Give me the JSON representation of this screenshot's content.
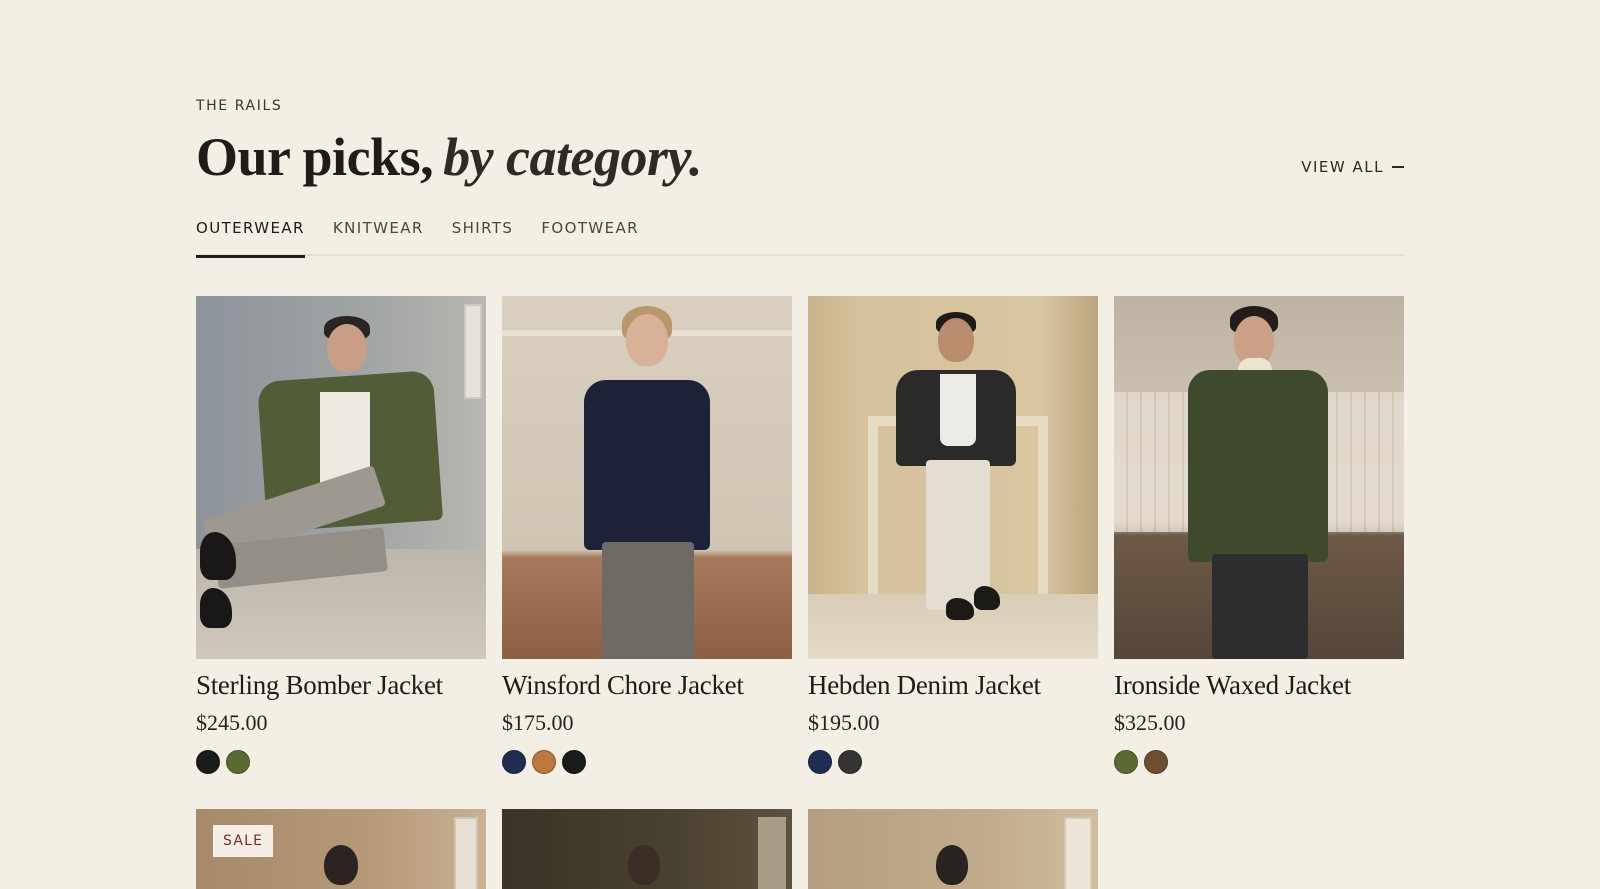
{
  "section": {
    "eyebrow": "THE RAILS",
    "headline_main": "Our picks,",
    "headline_accent": "by category.",
    "view_all_label": "VIEW ALL"
  },
  "tabs": [
    {
      "label": "OUTERWEAR",
      "active": true
    },
    {
      "label": "KNITWEAR",
      "active": false
    },
    {
      "label": "SHIRTS",
      "active": false
    },
    {
      "label": "FOOTWEAR",
      "active": false
    }
  ],
  "products": [
    {
      "name": "Sterling Bomber Jacket",
      "price": "$245.00",
      "swatches": [
        "#1c1c1a",
        "#5b6a33"
      ]
    },
    {
      "name": "Winsford Chore Jacket",
      "price": "$175.00",
      "swatches": [
        "#1f2d52",
        "#b9793f",
        "#1a1a18"
      ]
    },
    {
      "name": "Hebden Denim Jacket",
      "price": "$195.00",
      "swatches": [
        "#1f2d52",
        "#353432"
      ]
    },
    {
      "name": "Ironside Waxed Jacket",
      "price": "$325.00",
      "swatches": [
        "#5b6a33",
        "#6e4f31"
      ]
    }
  ],
  "row2": {
    "sale_badge": "SALE"
  },
  "colors": {
    "background": "#f4efe5",
    "text": "#1f1d18",
    "sale": "#7a2a20"
  }
}
